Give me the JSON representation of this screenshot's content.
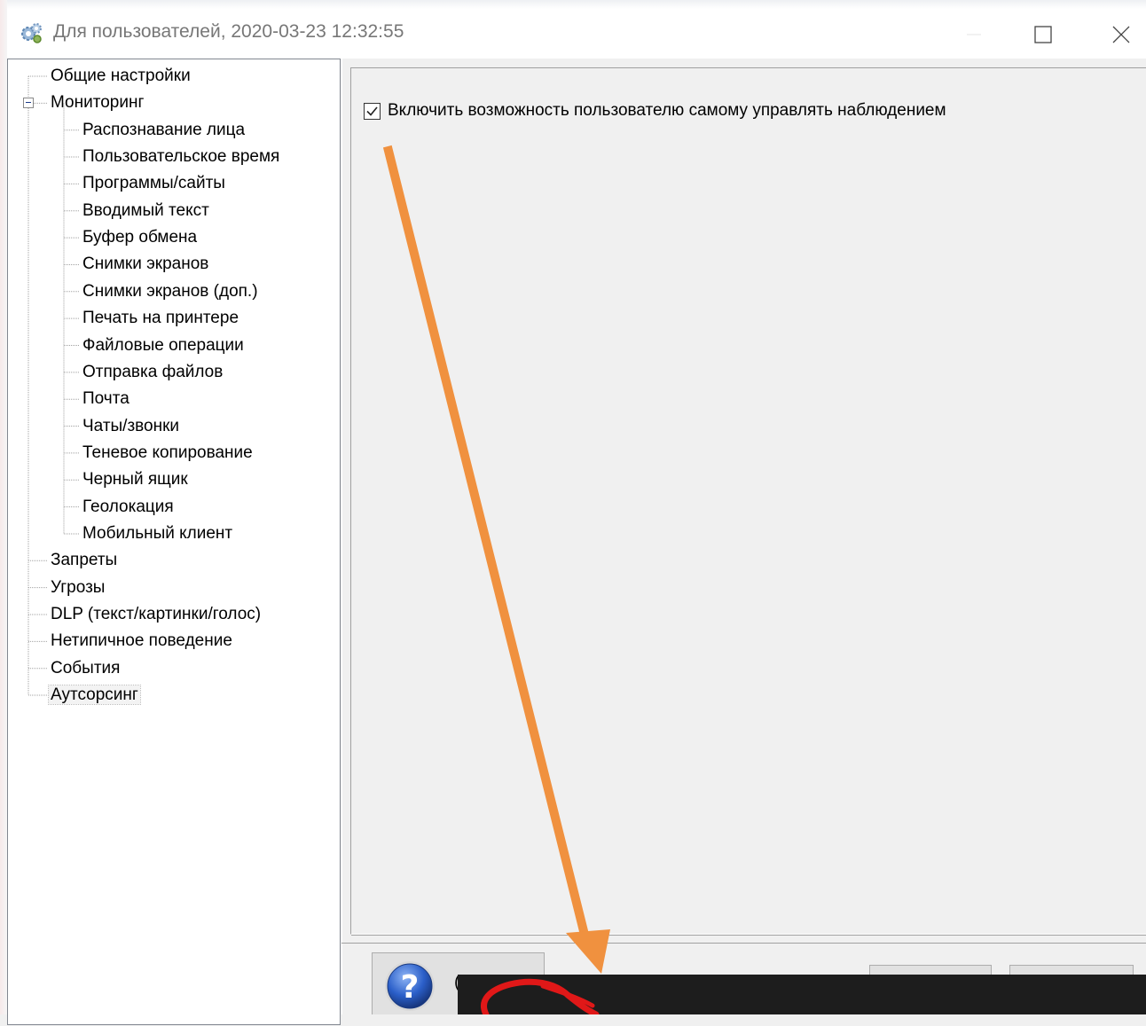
{
  "window": {
    "title": "Для пользователей, 2020-03-23 12:32:55"
  },
  "tree": {
    "items": [
      {
        "label": "Общие настройки",
        "level": 0
      },
      {
        "label": "Мониторинг",
        "level": 0,
        "expanded": true
      },
      {
        "label": "Распознавание лица",
        "level": 1
      },
      {
        "label": "Пользовательское время",
        "level": 1
      },
      {
        "label": "Программы/сайты",
        "level": 1
      },
      {
        "label": "Вводимый текст",
        "level": 1
      },
      {
        "label": "Буфер обмена",
        "level": 1
      },
      {
        "label": "Снимки экранов",
        "level": 1
      },
      {
        "label": "Снимки экранов (доп.)",
        "level": 1
      },
      {
        "label": "Печать на принтере",
        "level": 1
      },
      {
        "label": "Файловые операции",
        "level": 1
      },
      {
        "label": "Отправка файлов",
        "level": 1
      },
      {
        "label": "Почта",
        "level": 1
      },
      {
        "label": "Чаты/звонки",
        "level": 1
      },
      {
        "label": "Теневое копирование",
        "level": 1
      },
      {
        "label": "Черный ящик",
        "level": 1
      },
      {
        "label": "Геолокация",
        "level": 1
      },
      {
        "label": "Мобильный клиент",
        "level": 1
      },
      {
        "label": "Запреты",
        "level": 0
      },
      {
        "label": "Угрозы",
        "level": 0
      },
      {
        "label": "DLP (текст/картинки/голос)",
        "level": 0
      },
      {
        "label": "Нетипичное поведение",
        "level": 0
      },
      {
        "label": "События",
        "level": 0
      },
      {
        "label": "Аутсорсинг",
        "level": 0,
        "selected": true
      }
    ]
  },
  "content": {
    "checkbox_label": "Включить возможность пользователю самому управлять наблюдением",
    "checkbox_checked": true
  },
  "footer": {
    "help_label": "("
  },
  "colors": {
    "arrow": "#f0913f",
    "annotation_red": "#e01818",
    "overlay": "#1d1d1d"
  }
}
